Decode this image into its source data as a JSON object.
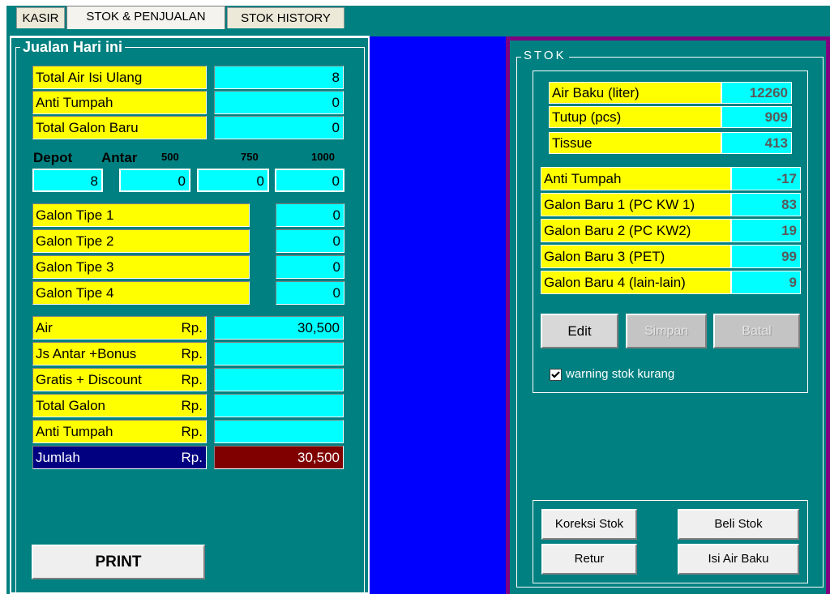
{
  "tabs": [
    {
      "label": "KASIR"
    },
    {
      "label": "STOK & PENJUALAN"
    },
    {
      "label": "STOK HISTORY"
    }
  ],
  "jualan": {
    "title": "Jualan Hari ini",
    "rows": [
      {
        "label": "Total Air Isi Ulang",
        "value": "8"
      },
      {
        "label": "Anti Tumpah",
        "value": "0"
      },
      {
        "label": "Total Galon Baru",
        "value": "0"
      }
    ],
    "depot_label": "Depot",
    "antar_label": "Antar",
    "antar_sizes": [
      "500",
      "750",
      "1000"
    ],
    "depot_values": [
      "8",
      "0",
      "0",
      "0"
    ],
    "galon_types": [
      {
        "label": "Galon Tipe 1",
        "value": "0"
      },
      {
        "label": "Galon Tipe 2",
        "value": "0"
      },
      {
        "label": "Galon Tipe 3",
        "value": "0"
      },
      {
        "label": "Galon Tipe 4",
        "value": "0"
      }
    ],
    "currency": "Rp.",
    "money_rows": [
      {
        "label": "Air",
        "value": "30,500"
      },
      {
        "label": "Js Antar +Bonus",
        "value": ""
      },
      {
        "label": "Gratis + Discount",
        "value": ""
      },
      {
        "label": "Total Galon",
        "value": ""
      },
      {
        "label": "Anti Tumpah",
        "value": ""
      }
    ],
    "total": {
      "label": "Jumlah",
      "value": "30,500"
    },
    "print_label": "PRINT"
  },
  "stok": {
    "title": "STOK",
    "basic": [
      {
        "label": "Air Baku (liter)",
        "value": "12260"
      },
      {
        "label": "Tutup (pcs)",
        "value": "909"
      },
      {
        "label": "Tissue",
        "value": "413"
      }
    ],
    "galon": [
      {
        "label": "Anti Tumpah",
        "value": "-17"
      },
      {
        "label": "Galon Baru 1 (PC KW 1)",
        "value": "83"
      },
      {
        "label": "Galon Baru 2 (PC KW2)",
        "value": "19"
      },
      {
        "label": "Galon Baru 3 (PET)",
        "value": "99"
      },
      {
        "label": "Galon Baru 4 (lain-lain)",
        "value": "9"
      }
    ],
    "edit_label": "Edit",
    "simpan_label": "Simpan",
    "batal_label": "Batal",
    "warning_label": "warning stok kurang",
    "warning_checked": true,
    "koreksi_label": "Koreksi Stok",
    "beli_label": "Beli Stok",
    "retur_label": "Retur",
    "isi_label": "Isi Air Baku"
  },
  "colors": {
    "teal": "#008080",
    "yellow": "#ffff00",
    "cyan": "#00ffff",
    "blue": "#0000ff",
    "purple": "#800080",
    "navy": "#000080",
    "maroon": "#800000"
  }
}
